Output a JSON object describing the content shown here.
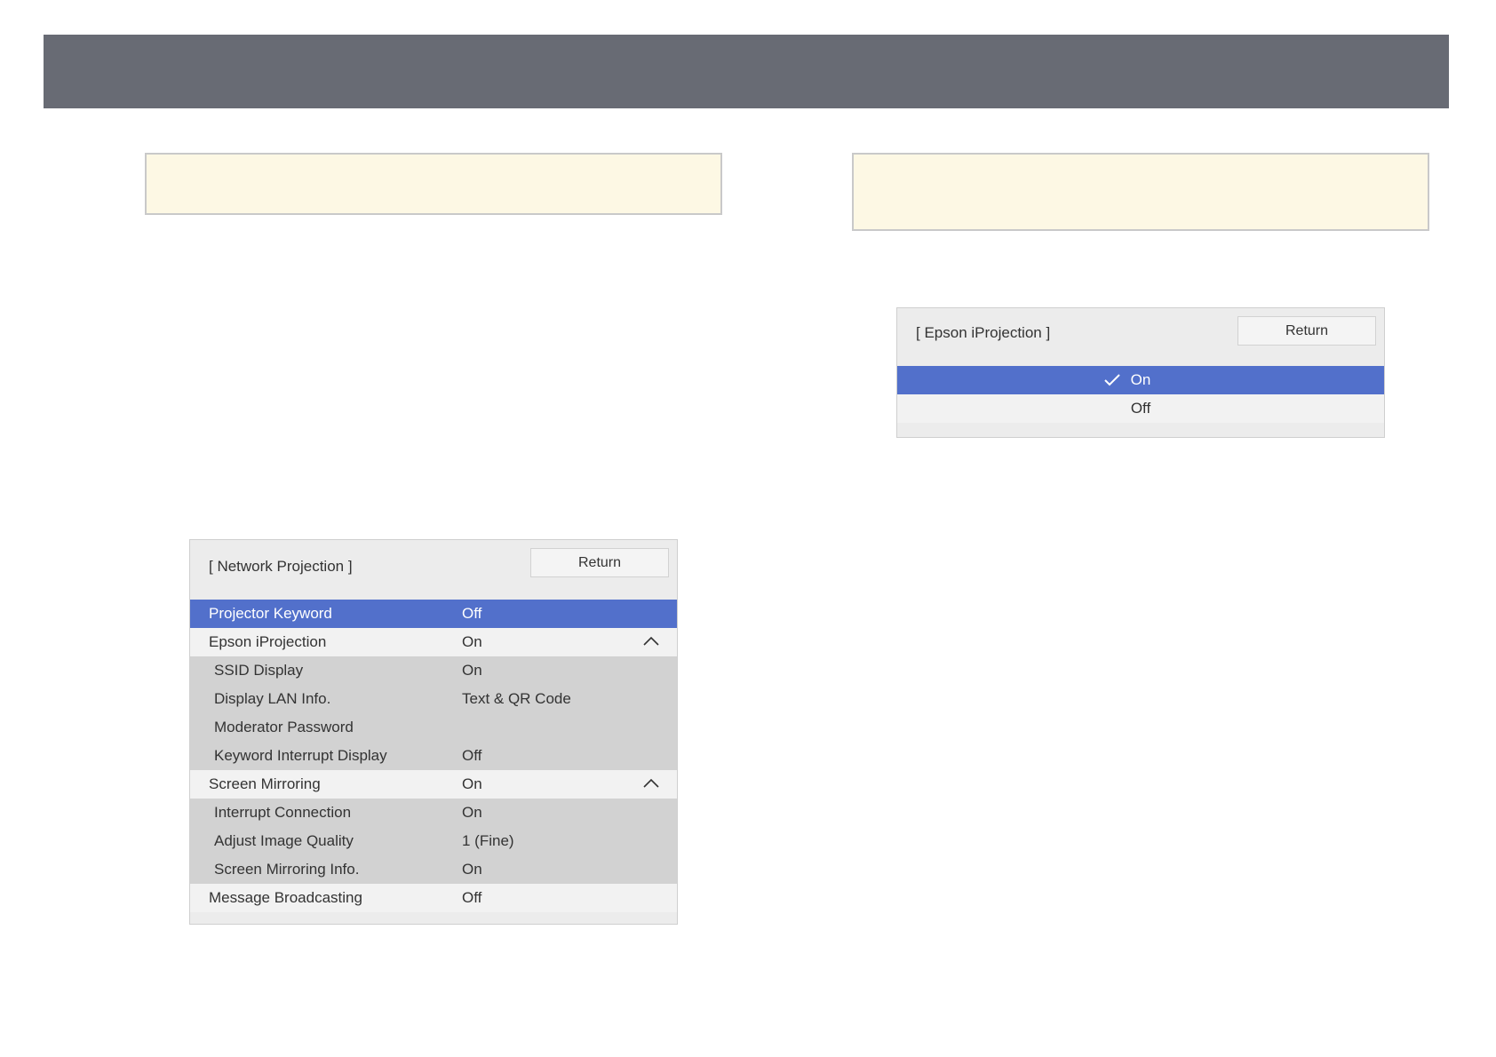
{
  "colors": {
    "top_bar": "#686b74",
    "note_background": "#fdf8e4",
    "selected_row": "#5270cb",
    "submenu_row": "#d2d2d2",
    "menu_background": "#ececec"
  },
  "network_projection_menu": {
    "title": "[ Network Projection ]",
    "return_label": "Return",
    "rows": [
      {
        "label": "Projector Keyword",
        "value": "Off"
      },
      {
        "label": "Epson iProjection",
        "value": "On",
        "icon": "chevron-up-icon"
      },
      {
        "label": "SSID Display",
        "value": "On"
      },
      {
        "label": "Display LAN Info.",
        "value": "Text & QR Code"
      },
      {
        "label": "Moderator Password",
        "value": ""
      },
      {
        "label": "Keyword Interrupt Display",
        "value": "Off"
      },
      {
        "label": "Screen Mirroring",
        "value": "On",
        "icon": "chevron-up-icon"
      },
      {
        "label": "Interrupt Connection",
        "value": "On"
      },
      {
        "label": "Adjust Image Quality",
        "value": "1 (Fine)"
      },
      {
        "label": "Screen Mirroring Info.",
        "value": "On"
      },
      {
        "label": "Message Broadcasting",
        "value": "Off"
      }
    ]
  },
  "epson_iprojection_menu": {
    "title": "[ Epson iProjection ]",
    "return_label": "Return",
    "options": [
      {
        "label": "On",
        "icon": "checkmark-icon"
      },
      {
        "label": "Off"
      }
    ]
  }
}
